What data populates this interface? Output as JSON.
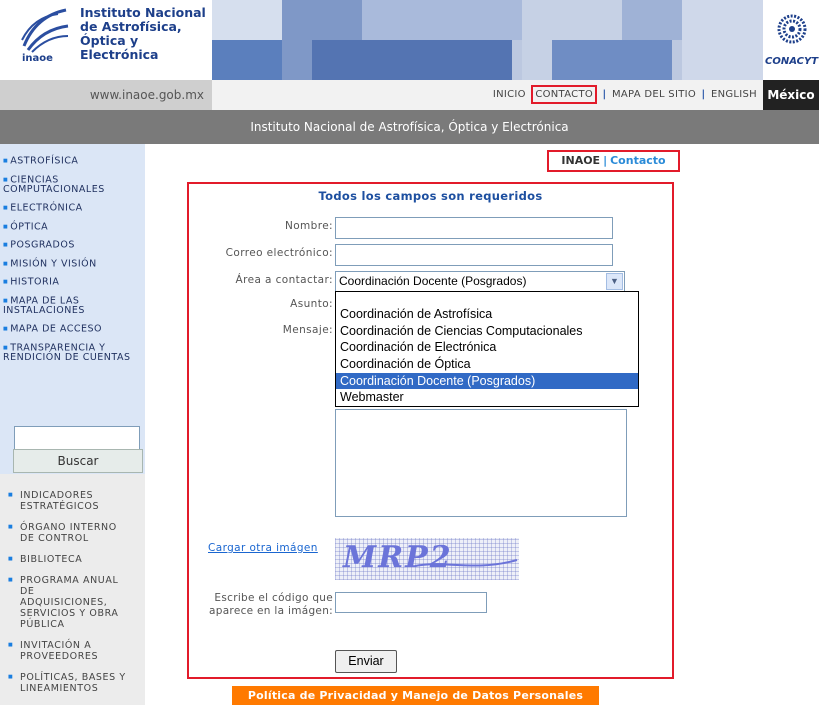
{
  "header": {
    "logo_text_lines": [
      "Instituto Nacional",
      "de Astrofísica,",
      "Óptica y Electrónica"
    ],
    "logo_acronym": "inaoe",
    "partner_logo_text": "CONACYT",
    "url": "www.inaoe.gob.mx",
    "country_label": "México",
    "top_nav": [
      "INICIO",
      "CONTACTO",
      "MAPA DEL SITIO",
      "ENGLISH"
    ],
    "page_banner": "Instituto Nacional de Astrofísica, Óptica y Electrónica"
  },
  "sidebar": {
    "items": [
      "ASTROFÍSICA",
      "CIENCIAS COMPUTACIONALES",
      "ELECTRÓNICA",
      "ÓPTICA",
      "POSGRADOS",
      "MISIÓN Y VISIÓN",
      "HISTORIA",
      "MAPA DE LAS INSTALACIONES",
      "MAPA DE ACCESO",
      "TRANSPARENCIA Y RENDICIÓN DE CUENTAS"
    ],
    "search_value": "",
    "search_button": "Buscar",
    "secondary_items": [
      "INDICADORES ESTRATÉGICOS",
      "ÓRGANO INTERNO DE CONTROL",
      "BIBLIOTECA",
      "PROGRAMA ANUAL DE ADQUISICIONES, SERVICIOS Y OBRA PÚBLICA",
      "INVITACIÓN A PROVEEDORES",
      "POLÍTICAS, BASES Y LINEAMIENTOS"
    ]
  },
  "breadcrumb": {
    "root": "INAOE",
    "separator": "|",
    "current": "Contacto"
  },
  "form": {
    "title": "Todos los campos son requeridos",
    "name_label": "Nombre:",
    "name_value": "",
    "email_label": "Correo electrónico:",
    "email_value": "",
    "area_label": "Área a contactar:",
    "area_selected": "Coordinación Docente (Posgrados)",
    "area_options": [
      "Coordinación de Astrofísica",
      "Coordinación de Ciencias Computacionales",
      "Coordinación de Electrónica",
      "Coordinación de Óptica",
      "Coordinación Docente (Posgrados)",
      "Webmaster"
    ],
    "area_highlighted_index": 4,
    "subject_label": "Asunto:",
    "message_label": "Mensaje:",
    "reload_link": "Cargar otra imágen",
    "captcha_text": "MRP2",
    "code_label": "Escribe el código que aparece en la imágen:",
    "code_value": "",
    "submit_label": "Enviar"
  },
  "footer": {
    "privacy_link": "Política de Privacidad y Manejo de Datos Personales"
  },
  "colors": {
    "highlight_border": "#e21b2a",
    "link_blue": "#2a8bd8",
    "privacy_orange": "#ff7a00",
    "selected_option": "#316ac5"
  }
}
